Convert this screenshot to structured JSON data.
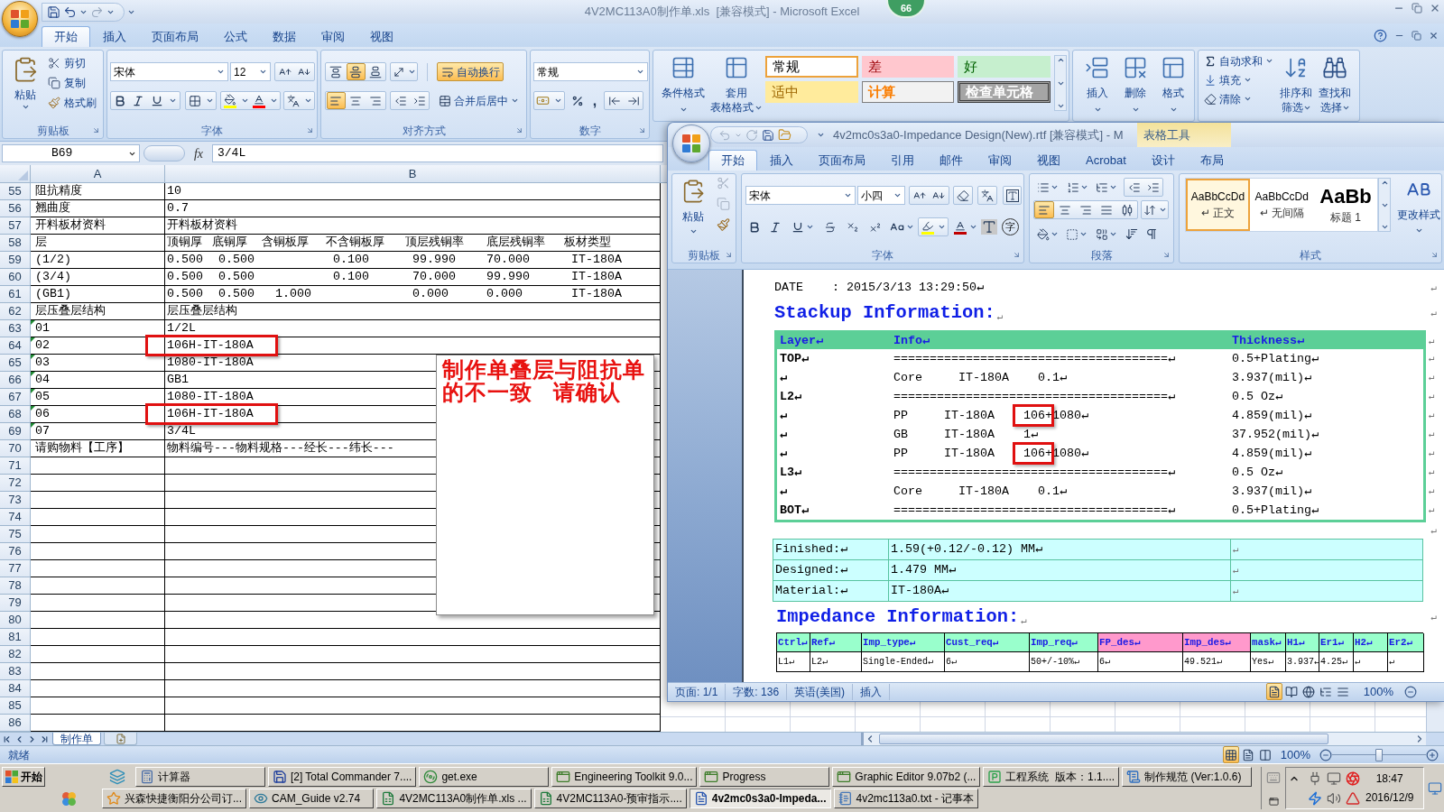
{
  "excel": {
    "title": "4V2MC113A0制作单.xls  [兼容模式] - Microsoft Excel",
    "tabs": [
      {
        "label": "开始",
        "selected": true
      },
      {
        "label": "插入",
        "selected": false
      },
      {
        "label": "页面布局",
        "selected": false
      },
      {
        "label": "公式",
        "selected": false
      },
      {
        "label": "数据",
        "selected": false
      },
      {
        "label": "审阅",
        "selected": false
      },
      {
        "label": "视图",
        "selected": false
      }
    ],
    "ribbon": {
      "clipboard": {
        "paste": "粘贴",
        "cut": "剪切",
        "copy": "复制",
        "painter": "格式刷",
        "label": "剪贴板"
      },
      "font": {
        "name": "宋体",
        "size": "12",
        "label": "字体"
      },
      "alignment": {
        "vertical": [
          {
            "kind": "top",
            "selected": false
          },
          {
            "kind": "middle",
            "selected": true
          },
          {
            "kind": "bottom",
            "selected": false
          }
        ],
        "horizontal": [
          {
            "kind": "left",
            "selected": true
          },
          {
            "kind": "center",
            "selected": false
          },
          {
            "kind": "right",
            "selected": false
          }
        ],
        "wrap": {
          "label": "自动换行",
          "selected": true
        },
        "merge": "合并后居中",
        "label": "对齐方式"
      },
      "number": {
        "format": "常规",
        "comma": ",",
        "label": "数字"
      },
      "styles": {
        "conditional": "条件格式",
        "table_format": [
          "套用",
          "表格格式"
        ],
        "gallery": [
          {
            "label": "常规",
            "kind": "normal",
            "selected": true
          },
          {
            "label": "差",
            "kind": "bad",
            "selected": false
          },
          {
            "label": "好",
            "kind": "good",
            "selected": false
          },
          {
            "label": "适中",
            "kind": "neutral",
            "selected": false
          },
          {
            "label": "计算",
            "kind": "calculation",
            "selected": false
          },
          {
            "label": "检查单元格",
            "kind": "check",
            "selected": false
          }
        ]
      },
      "cells": [
        "插入",
        "删除",
        "格式"
      ],
      "editing": {
        "autosum": "自动求和",
        "fill": "填充",
        "clear": "清除",
        "sort": [
          "排序和",
          "筛选"
        ],
        "find": [
          "查找和",
          "选择"
        ]
      }
    },
    "name_box": "B69",
    "function_button": "fx",
    "formula": "3/4L",
    "columns": [
      "A",
      "B"
    ],
    "rows": [
      {
        "row": "55",
        "a": "阻抗精度",
        "b": "10",
        "highlighted": false,
        "text_number": false
      },
      {
        "row": "56",
        "a": "翘曲度",
        "b": "0.7",
        "highlighted": false,
        "text_number": false
      },
      {
        "row": "57",
        "a": "开料板材资料",
        "b": "开料板材资料",
        "highlighted": false,
        "text_number": false
      },
      {
        "row": "58",
        "a": "层",
        "b_headings": [
          "顶铜厚",
          "底铜厚",
          "含铜板厚",
          "不含铜板厚",
          "顶层残铜率",
          "底层残铜率",
          "板材类型"
        ],
        "highlighted": false,
        "text_number": false
      },
      {
        "row": "59",
        "a": "(1/2)",
        "b_values": {
          "top_copper": "0.500",
          "bottom_copper": "0.500",
          "board_without_copper": "0.100",
          "top_residual_copper": "99.990",
          "bottom_residual_copper": "70.000",
          "material": "IT-180A"
        },
        "highlighted": false,
        "text_number": false
      },
      {
        "row": "60",
        "a": "(3/4)",
        "b_values": {
          "top_copper": "0.500",
          "bottom_copper": "0.500",
          "board_without_copper": "0.100",
          "top_residual_copper": "70.000",
          "bottom_residual_copper": "99.990",
          "material": "IT-180A"
        },
        "highlighted": false,
        "text_number": false
      },
      {
        "row": "61",
        "a": "(GB1)",
        "b_values": {
          "top_copper": "0.500",
          "bottom_copper": "0.500",
          "board_with_copper": "1.000",
          "top_residual_copper": "0.000",
          "bottom_residual_copper": "0.000",
          "material": "IT-180A"
        },
        "highlighted": false,
        "text_number": false
      },
      {
        "row": "62",
        "a": "层压叠层结构",
        "b": "层压叠层结构",
        "highlighted": false,
        "text_number": false
      },
      {
        "row": "63",
        "a": "01",
        "b": "1/2L",
        "highlighted": false,
        "text_number": true
      },
      {
        "row": "64",
        "a": "02",
        "b": "106H-IT-180A",
        "highlighted": true,
        "text_number": true
      },
      {
        "row": "65",
        "a": "03",
        "b": "1080-IT-180A",
        "highlighted": false,
        "text_number": true
      },
      {
        "row": "66",
        "a": "04",
        "b": "GB1",
        "highlighted": false,
        "text_number": true
      },
      {
        "row": "67",
        "a": "05",
        "b": "1080-IT-180A",
        "highlighted": false,
        "text_number": true
      },
      {
        "row": "68",
        "a": "06",
        "b": "106H-IT-180A",
        "highlighted": true,
        "text_number": true
      },
      {
        "row": "69",
        "a": "07",
        "b": "3/4L",
        "highlighted": false,
        "text_number": true
      },
      {
        "row": "70",
        "a": "请购物料【工序】",
        "b": "物料编号---物料规格---经长---纬长---",
        "highlighted": false,
        "text_number": false
      },
      {
        "row": "71",
        "highlighted": false,
        "text_number": false
      },
      {
        "row": "72",
        "highlighted": false,
        "text_number": false
      },
      {
        "row": "73",
        "highlighted": false,
        "text_number": false
      },
      {
        "row": "74",
        "highlighted": false,
        "text_number": false
      },
      {
        "row": "75",
        "highlighted": false,
        "text_number": false
      },
      {
        "row": "76",
        "highlighted": false,
        "text_number": false
      },
      {
        "row": "77",
        "highlighted": false,
        "text_number": false
      },
      {
        "row": "78",
        "highlighted": false,
        "text_number": false
      },
      {
        "row": "79",
        "highlighted": false,
        "text_number": false
      },
      {
        "row": "80",
        "highlighted": false,
        "text_number": false
      },
      {
        "row": "81",
        "highlighted": false,
        "text_number": false
      },
      {
        "row": "82",
        "highlighted": false,
        "text_number": false
      },
      {
        "row": "83",
        "highlighted": false,
        "text_number": false
      },
      {
        "row": "84",
        "highlighted": false,
        "text_number": false
      },
      {
        "row": "85",
        "highlighted": false,
        "text_number": false
      },
      {
        "row": "86",
        "highlighted": false,
        "text_number": false
      }
    ],
    "note": "制作单叠层与阻抗单的不一致   请确认",
    "sheet_tabs": [
      {
        "label": "制作单",
        "selected": true
      }
    ],
    "status": "就绪",
    "views": [
      {
        "kind": "normal",
        "selected": true
      },
      {
        "kind": "layout",
        "selected": false
      },
      {
        "kind": "break",
        "selected": false
      }
    ],
    "zoom": "100%",
    "zoom_slider": {
      "level": 0.5
    }
  },
  "badge": "66",
  "word": {
    "title": "4v2mc0s3a0-Impedance Design(New).rtf [兼容模式] - M",
    "context_tab": "表格工具",
    "tabs": [
      {
        "label": "开始",
        "selected": true
      },
      {
        "label": "插入",
        "selected": false
      },
      {
        "label": "页面布局",
        "selected": false
      },
      {
        "label": "引用",
        "selected": false
      },
      {
        "label": "邮件",
        "selected": false
      },
      {
        "label": "审阅",
        "selected": false
      },
      {
        "label": "视图",
        "selected": false
      },
      {
        "label": "Acrobat",
        "selected": false
      },
      {
        "label": "设计",
        "selected": false
      },
      {
        "label": "布局",
        "selected": false
      }
    ],
    "ribbon": {
      "clipboard": {
        "paste": "粘贴",
        "label": "剪贴板"
      },
      "font": {
        "name": "宋体",
        "size": "小四",
        "enclose": "字",
        "label": "字体"
      },
      "paragraph": {
        "align": [
          {
            "kind": "left",
            "selected": true
          },
          {
            "kind": "center",
            "selected": false
          },
          {
            "kind": "right",
            "selected": false
          },
          {
            "kind": "justify",
            "selected": false
          },
          {
            "kind": "distributed",
            "selected": false
          }
        ],
        "label": "段落"
      },
      "styles": {
        "gallery": [
          {
            "sample": "AaBbCcDd",
            "label": "↵ 正文",
            "kind": "body",
            "selected": true
          },
          {
            "sample": "AaBbCcDd",
            "label": "↵ 无间隔",
            "kind": "body",
            "selected": false
          },
          {
            "sample": "AaBb",
            "label": "标题 1",
            "kind": "heading",
            "selected": false
          }
        ],
        "change": "更改样式",
        "label": "样式"
      }
    },
    "document": {
      "date": {
        "text": "DATE    : 2015/3/13 13:29:50↵",
        "end": "↵"
      },
      "stackup_title": {
        "text": "Stackup Information:",
        "mark": "↵",
        "end": "↵"
      },
      "stackup": {
        "columns": [
          "Layer↵",
          "Info↵",
          "Thickness↵"
        ],
        "end": "↵",
        "rows": [
          {
            "layer": "TOP↵",
            "info": "======================================↵",
            "thickness": "0.5+Plating↵",
            "highlighted": false,
            "end": "↵"
          },
          {
            "layer": "↵",
            "info": "Core     IT-180A    0.1↵",
            "thickness": "3.937(mil)↵",
            "highlighted": false,
            "end": "↵"
          },
          {
            "layer": "L2↵",
            "info": "======================================↵",
            "thickness": "0.5 Oz↵",
            "highlighted": false,
            "end": "↵"
          },
          {
            "layer": "↵",
            "info": "PP     IT-180A    106+1080↵",
            "thickness": "4.859(mil)↵",
            "highlighted": true,
            "end": "↵"
          },
          {
            "layer": "↵",
            "info": "GB     IT-180A    1↵",
            "thickness": "37.952(mil)↵",
            "highlighted": false,
            "end": "↵"
          },
          {
            "layer": "↵",
            "info": "PP     IT-180A    106+1080↵",
            "thickness": "4.859(mil)↵",
            "highlighted": true,
            "end": "↵"
          },
          {
            "layer": "L3↵",
            "info": "======================================↵",
            "thickness": "0.5 Oz↵",
            "highlighted": false,
            "end": "↵"
          },
          {
            "layer": "↵",
            "info": "Core     IT-180A    0.1↵",
            "thickness": "3.937(mil)↵",
            "highlighted": false,
            "end": "↵"
          },
          {
            "layer": "BOT↵",
            "info": "======================================↵",
            "thickness": "0.5+Plating↵",
            "highlighted": false,
            "end": "↵"
          }
        ]
      },
      "spacer_end": "↵",
      "finish": [
        {
          "label": "Finished:↵",
          "value": "1.59(+0.12/-0.12) MM↵",
          "note": "↵"
        },
        {
          "label": "Designed:↵",
          "value": "1.479 MM↵",
          "note": "↵"
        },
        {
          "label": "Material:↵",
          "value": "IT-180A↵",
          "note": "↵"
        }
      ],
      "impedance_title": {
        "text": "Impedance Information:",
        "mark": "↵",
        "end": "↵"
      },
      "impedance": {
        "columns": [
          {
            "label": "Ctrl↵",
            "color": "#99ffcc"
          },
          {
            "label": "Ref↵",
            "color": "#99ffcc"
          },
          {
            "label": "Imp_type↵",
            "color": "#99ffcc"
          },
          {
            "label": "Cust_req↵",
            "color": "#99ffcc"
          },
          {
            "label": "Imp_req↵",
            "color": "#99ffcc"
          },
          {
            "label": "FP_des↵",
            "color": "#ff99cc"
          },
          {
            "label": "Imp_des↵",
            "color": "#ff99cc"
          },
          {
            "label": "mask↵",
            "color": "#99ffcc"
          },
          {
            "label": "H1↵",
            "color": "#99ffcc"
          },
          {
            "label": "Er1↵",
            "color": "#99ffcc"
          },
          {
            "label": "H2↵",
            "color": "#99ffcc"
          },
          {
            "label": "Er2↵",
            "color": "#99ffcc"
          }
        ],
        "rows": [
          [
            "L1↵",
            "L2↵",
            "Single-Ended↵",
            "6↵",
            "50+/-10%↵",
            "6↵",
            "49.521↵",
            "Yes↵",
            "3.937↵",
            "4.25↵",
            "↵",
            "↵"
          ]
        ]
      }
    },
    "status": {
      "page": "页面: 1/1",
      "words": "字数: 136",
      "language": "英语(美国)",
      "mode": "插入",
      "views": [
        {
          "kind": "print",
          "selected": true
        },
        {
          "kind": "reading",
          "selected": false
        },
        {
          "kind": "web",
          "selected": false
        },
        {
          "kind": "outline",
          "selected": false
        },
        {
          "kind": "draft",
          "selected": false
        }
      ],
      "zoom": "100%"
    }
  },
  "taskbar": {
    "start": "开始",
    "top_row": [
      {
        "label": "计算器",
        "kind": "calculator",
        "selected": false
      },
      {
        "label": "[2] Total Commander 7....",
        "kind": "disk",
        "selected": false
      },
      {
        "label": "get.exe",
        "kind": "program",
        "selected": false
      },
      {
        "label": "Engineering Toolkit 9.0...",
        "kind": "tool",
        "selected": false
      },
      {
        "label": "Progress",
        "kind": "tool",
        "selected": false
      },
      {
        "label": "Graphic Editor 9.07b2 (...",
        "kind": "tool",
        "selected": false
      },
      {
        "label": "工程系统  版本：1.1....",
        "kind": "system",
        "selected": false
      },
      {
        "label": "制作规范 (Ver:1.0.6)",
        "kind": "list",
        "selected": false
      }
    ],
    "bottom_row": [
      {
        "label": "兴森快捷衡阳分公司订...",
        "kind": "star",
        "selected": false
      },
      {
        "label": "CAM_Guide v2.74",
        "kind": "eye",
        "selected": false
      },
      {
        "label": "4V2MC113A0制作单.xls ...",
        "kind": "sheet",
        "selected": false
      },
      {
        "label": "4V2MC113A0-预审指示....",
        "kind": "sheet",
        "selected": false
      },
      {
        "label": "4v2mc0s3a0-Impeda...",
        "kind": "document",
        "selected": true
      },
      {
        "label": "4v2mc113a0.txt - 记事本",
        "kind": "notepad",
        "selected": false
      }
    ],
    "time": "18:47",
    "date": "2016/12/9"
  }
}
